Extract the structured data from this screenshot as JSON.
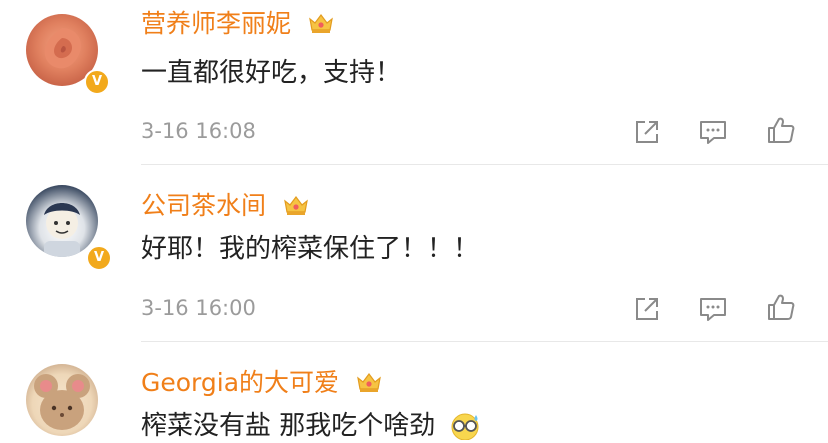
{
  "comments": [
    {
      "username": "营养师李丽妮",
      "text": "一直都很好吃，支持！",
      "time": "3-16 16:08"
    },
    {
      "username": "公司茶水间",
      "text": "好耶！我的榨菜保住了！！！",
      "time": "3-16 16:00"
    },
    {
      "username": "Georgia的大可爱",
      "text": "榨菜没有盐 那我吃个啥劲",
      "time": ""
    }
  ],
  "colors": {
    "username": "#f07f19",
    "text": "#222222",
    "timestamp": "#9b9b9b",
    "icon": "#8a8a8a",
    "verified_badge": "#f2a91c"
  },
  "icons": {
    "verified": "verified-v-icon",
    "membership": "crown-icon",
    "share": "share-icon",
    "reply": "comment-icon",
    "like": "thumbs-up-icon",
    "emoji": "sweat-glasses-emoji"
  }
}
